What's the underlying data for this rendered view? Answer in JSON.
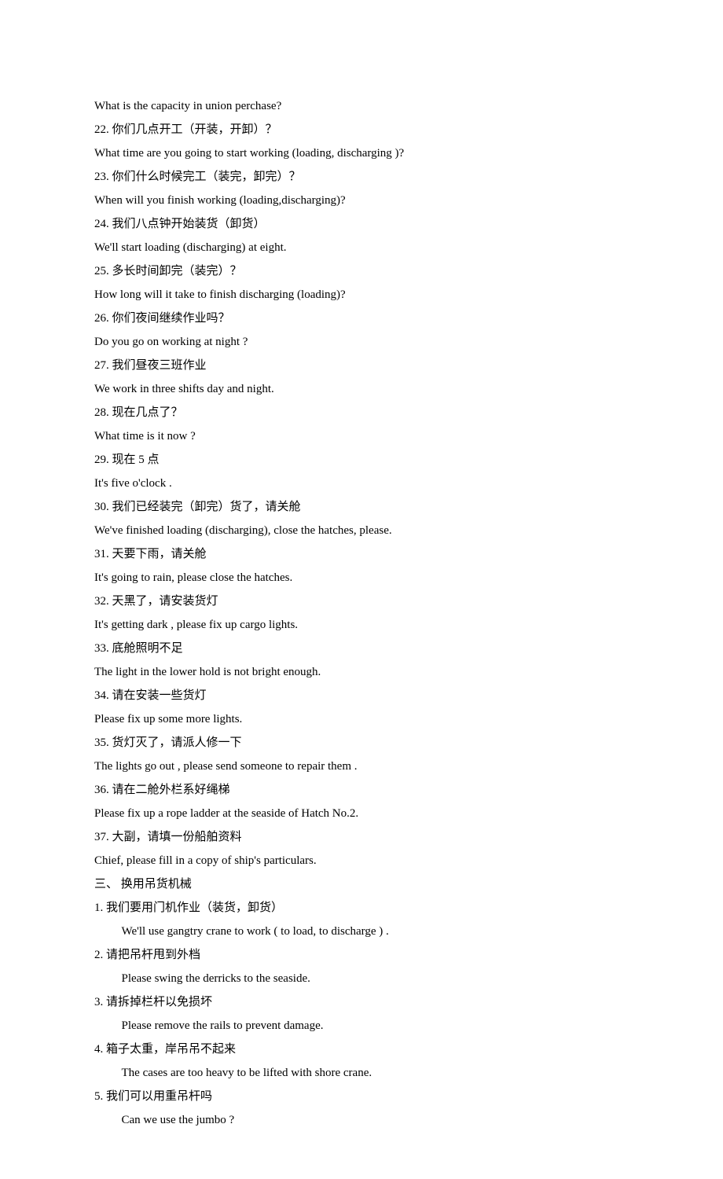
{
  "lines": [
    {
      "text": "What is the capacity in union perchase?"
    },
    {
      "text": "22. 你们几点开工（开装，开卸）？"
    },
    {
      "text": "What time are you going to start working (loading, discharging )?"
    },
    {
      "text": "23. 你们什么时候完工（装完，卸完）？"
    },
    {
      "text": "When will you finish working (loading,discharging)?"
    },
    {
      "text": "24. 我们八点钟开始装货（卸货）"
    },
    {
      "text": "We'll start loading (discharging) at eight."
    },
    {
      "text": "25. 多长时间卸完（装完）？"
    },
    {
      "text": "How long will it take to finish discharging (loading)?"
    },
    {
      "text": "26. 你们夜间继续作业吗？"
    },
    {
      "text": "Do you go on working at night ?"
    },
    {
      "text": "27. 我们昼夜三班作业"
    },
    {
      "text": "We work in three shifts day and night."
    },
    {
      "text": "28. 现在几点了？"
    },
    {
      "text": "What time is it now ?"
    },
    {
      "text": "29. 现在 5 点"
    },
    {
      "text": "It's five o'clock ."
    },
    {
      "text": "30. 我们已经装完（卸完）货了，请关舱"
    },
    {
      "text": "We've finished loading (discharging), close the hatches, please."
    },
    {
      "text": "31. 天要下雨，请关舱"
    },
    {
      "text": "It's going to rain, please close the hatches."
    },
    {
      "text": "32. 天黑了，请安装货灯"
    },
    {
      "text": "It's getting dark , please fix up cargo lights."
    },
    {
      "text": "33. 底舱照明不足"
    },
    {
      "text": "The light in the lower hold is not bright enough."
    },
    {
      "text": "34. 请在安装一些货灯"
    },
    {
      "text": "Please fix up some more lights."
    },
    {
      "text": "35. 货灯灭了，请派人修一下"
    },
    {
      "text": "The lights go out , please send someone to repair them ."
    },
    {
      "text": "36. 请在二舱外栏系好绳梯"
    },
    {
      "text": "Please fix up a rope ladder at the seaside of Hatch No.2."
    },
    {
      "text": "37. 大副，请填一份船舶资料"
    },
    {
      "text": "Chief, please fill in a copy of ship's particulars."
    },
    {
      "text": "三、 换用吊货机械"
    },
    {
      "text": "1. 我们要用门机作业（装货，卸货）"
    },
    {
      "text": "We'll use gangtry crane to work ( to load, to discharge ) .",
      "indent": true
    },
    {
      "text": "2. 请把吊杆甩到外档"
    },
    {
      "text": "Please swing the derricks to the seaside.",
      "indent": true
    },
    {
      "text": "3. 请拆掉栏杆以免损坏"
    },
    {
      "text": "Please remove the rails to prevent damage.",
      "indent": true
    },
    {
      "text": "4. 箱子太重，岸吊吊不起来"
    },
    {
      "text": "The cases are too heavy to be lifted with shore crane.",
      "indent": true
    },
    {
      "text": "5. 我们可以用重吊杆吗"
    },
    {
      "text": "Can we use the jumbo ?",
      "indent": true
    }
  ]
}
